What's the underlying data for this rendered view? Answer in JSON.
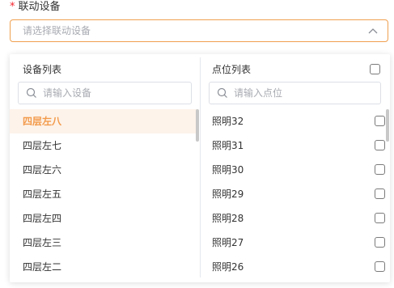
{
  "field": {
    "required_mark": "*",
    "label": "联动设备",
    "placeholder": "请选择联动设备"
  },
  "device_panel": {
    "title": "设备列表",
    "search_placeholder": "请输入设备",
    "items": [
      "四层左八",
      "四层左七",
      "四层左六",
      "四层左五",
      "四层左四",
      "四层左三",
      "四层左二"
    ],
    "selected": "四层左八"
  },
  "point_panel": {
    "title": "点位列表",
    "search_placeholder": "请输入点位",
    "items": [
      "照明32",
      "照明31",
      "照明30",
      "照明29",
      "照明28",
      "照明27",
      "照明26"
    ]
  },
  "colors": {
    "accent": "#f39a4a",
    "selected_bg": "#fdf3ea",
    "required": "#f5222d"
  }
}
